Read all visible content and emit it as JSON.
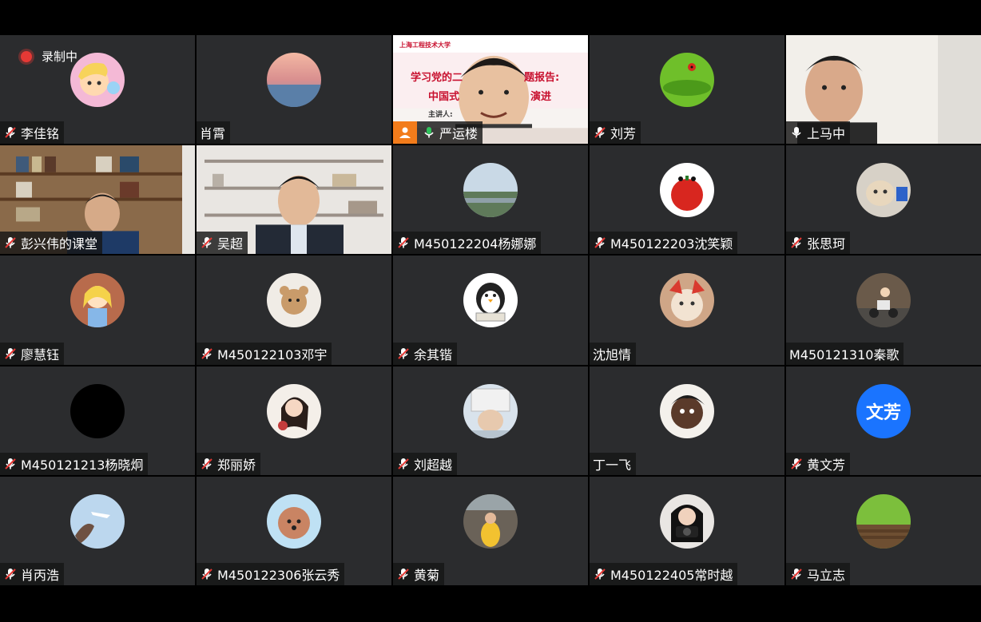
{
  "recording": {
    "label": "录制中"
  },
  "participants": [
    {
      "name": "李佳铭",
      "muted": true,
      "kind": "avatar",
      "avatar": "cartoon-boy"
    },
    {
      "name": "肖霄",
      "muted": false,
      "kind": "avatar",
      "avatar": "sunset-sky"
    },
    {
      "name": "严运楼",
      "muted": false,
      "kind": "video",
      "video": "presenter",
      "speaking": true
    },
    {
      "name": "刘芳",
      "muted": true,
      "kind": "avatar",
      "avatar": "ladybug-leaf"
    },
    {
      "name": "上马中",
      "muted": false,
      "kind": "video",
      "video": "elder-man"
    },
    {
      "name": "彭兴伟的课堂",
      "muted": true,
      "kind": "video",
      "video": "bookshelf-man"
    },
    {
      "name": "吴超",
      "muted": true,
      "kind": "video",
      "video": "office-man"
    },
    {
      "name": "M450122204杨娜娜",
      "muted": true,
      "kind": "avatar",
      "avatar": "landscape"
    },
    {
      "name": "M450122203沈笑颖",
      "muted": true,
      "kind": "avatar",
      "avatar": "apple-face"
    },
    {
      "name": "张思珂",
      "muted": true,
      "kind": "avatar",
      "avatar": "cat"
    },
    {
      "name": "廖慧钰",
      "muted": true,
      "kind": "avatar",
      "avatar": "alice"
    },
    {
      "name": "M450122103邓宇",
      "muted": true,
      "kind": "avatar",
      "avatar": "teddy-bear"
    },
    {
      "name": "余其锴",
      "muted": true,
      "kind": "avatar",
      "avatar": "penguin"
    },
    {
      "name": "沈旭情",
      "muted": false,
      "kind": "avatar",
      "avatar": "cat-hat"
    },
    {
      "name": "M450121310秦歌",
      "muted": false,
      "kind": "avatar",
      "avatar": "scooter"
    },
    {
      "name": "M450121213杨晓炯",
      "muted": true,
      "kind": "avatar",
      "avatar": "black"
    },
    {
      "name": "郑丽娇",
      "muted": true,
      "kind": "avatar",
      "avatar": "girl-drawing"
    },
    {
      "name": "刘超越",
      "muted": true,
      "kind": "avatar",
      "avatar": "hand-photo"
    },
    {
      "name": "丁一飞",
      "muted": false,
      "kind": "avatar",
      "avatar": "face-art"
    },
    {
      "name": "黄文芳",
      "muted": true,
      "kind": "text",
      "text": "文芳"
    },
    {
      "name": "肖丙浩",
      "muted": true,
      "kind": "avatar",
      "avatar": "sky-plane"
    },
    {
      "name": "M450122306张云秀",
      "muted": true,
      "kind": "avatar",
      "avatar": "poodle"
    },
    {
      "name": "黄菊",
      "muted": true,
      "kind": "avatar",
      "avatar": "street-yellow"
    },
    {
      "name": "M450122405常时越",
      "muted": true,
      "kind": "avatar",
      "avatar": "camera-girl"
    },
    {
      "name": "马立志",
      "muted": true,
      "kind": "avatar",
      "avatar": "grass-field"
    }
  ],
  "slide": {
    "line1": "学习党的二",
    "line1b": "题报告:",
    "line2": "中国式",
    "line2b": "演进",
    "footer": "主讲人:"
  }
}
